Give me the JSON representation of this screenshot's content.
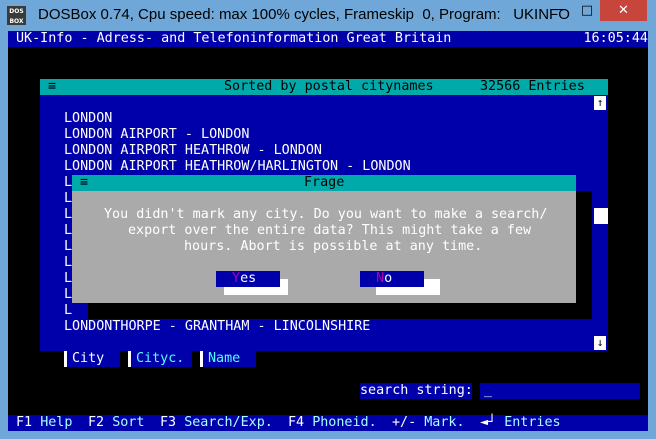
{
  "window": {
    "title": "DOSBox 0.74, Cpu speed: max 100% cycles, Frameskip  0, Program:   UKINFO",
    "icon_text": [
      "DOS",
      "BOX"
    ],
    "buttons": {
      "minimize": "─",
      "maximize": "□",
      "close": "✕"
    }
  },
  "app": {
    "title": "UK-Info - Adress- and Telefoninformation Great Britain",
    "clock": "16:05:44"
  },
  "list": {
    "menu_glyph": "≡",
    "header": "Sorted by postal citynames",
    "count": "32566 Entries",
    "rows": [
      "LONDON",
      "LONDON AIRPORT - LONDON",
      "LONDON AIRPORT HEATHROW - LONDON",
      "LONDON AIRPORT HEATHROW/HARLINGTON - LONDON",
      "L",
      "L",
      "L",
      "L",
      "L",
      "L",
      "L",
      "L",
      "L",
      "LONDONTHORPE - GRANTHAM - LINCOLNSHIRE"
    ],
    "scroll_up": "↑",
    "scroll_down": "↓",
    "tabs": [
      "City",
      "Cityc.",
      "Name"
    ]
  },
  "dialog": {
    "menu_glyph": "≡",
    "title": "Frage",
    "message": [
      "You didn't mark any city. Do you want to make a search/",
      "export over the entire data? This might take a few",
      "hours. Abort is possible at any time."
    ],
    "yes_hotkey": "Y",
    "yes_rest": "es",
    "no_hotkey": "N",
    "no_rest": "o"
  },
  "search": {
    "label": "search string:",
    "value": "_"
  },
  "statusbar": [
    {
      "key": "F1",
      "label": "Help"
    },
    {
      "key": "F2",
      "label": "Sort"
    },
    {
      "key": "F3",
      "label": "Search/Exp."
    },
    {
      "key": "F4",
      "label": "Phoneid."
    },
    {
      "key": "+/-",
      "label": "Mark."
    },
    {
      "key": "◄┘",
      "label": "Entries"
    }
  ],
  "colors": {
    "dos_blue": "#0000aa",
    "dos_cyan": "#00aaaa",
    "dos_gray": "#aaaaaa",
    "hotkey_magenta": "#aa00aa",
    "window_chrome": "#6fa8d8",
    "close_red": "#c7453b"
  }
}
